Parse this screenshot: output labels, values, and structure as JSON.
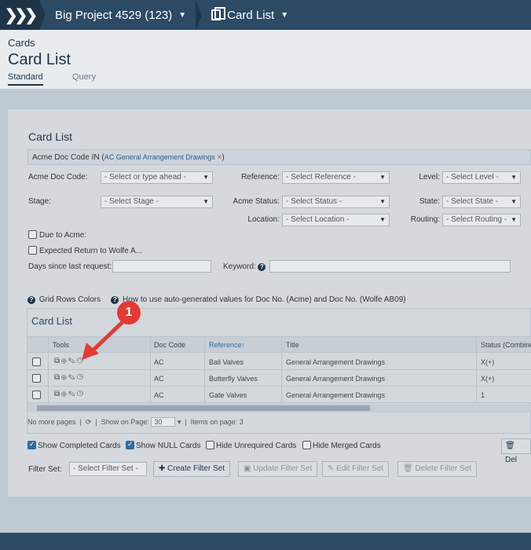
{
  "nav": {
    "project": "Big Project 4529 (123)",
    "page": "Card List"
  },
  "header": {
    "section": "Cards",
    "title": "Card List",
    "tabs": [
      "Standard",
      "Query"
    ]
  },
  "card": {
    "title": "Card List",
    "filter_prefix": "Acme Doc Code IN (",
    "filter_tag": "AC General Arrangement Drawings",
    "filter_close": "×",
    "filter_suffix": ")"
  },
  "filters": {
    "acme_doc_code": {
      "label": "Acme Doc Code:",
      "value": "- Select or type ahead -"
    },
    "reference": {
      "label": "Reference:",
      "value": "- Select Reference -"
    },
    "level": {
      "label": "Level:",
      "value": "- Select Level -"
    },
    "stage": {
      "label": "Stage:",
      "value": "- Select Stage -"
    },
    "acme_status": {
      "label": "Acme Status:",
      "value": "- Select Status -"
    },
    "state": {
      "label": "State:",
      "value": "- Select State -"
    },
    "location": {
      "label": "Location:",
      "value": "- Select Location -"
    },
    "routing": {
      "label": "Routing:",
      "value": "- Select Routing -"
    },
    "due_to_acme": "Due to Acme:",
    "expected_return": "Expected Return to Wolfe A...",
    "days_since": "Days since last request:",
    "keyword": "Keyword:"
  },
  "help_links": {
    "grid_colors": "Grid Rows Colors",
    "auto_values": "How to use auto-generated values for Doc No. (Acme) and Doc No. (Wolfe AB09)"
  },
  "grid": {
    "title": "Card List",
    "columns": [
      "Tools",
      "Doc Code",
      "Reference",
      "Title",
      "Status (Combine"
    ],
    "sort_indicator": "↑",
    "rows": [
      {
        "doc_code": "AC",
        "reference": "Ball Valves",
        "title": "General Arrangement Drawings",
        "status": "X(+)"
      },
      {
        "doc_code": "AC",
        "reference": "Butterfly Valves",
        "title": "General Arrangement Drawings",
        "status": "X(+)"
      },
      {
        "doc_code": "AC",
        "reference": "Gate Valves",
        "title": "General Arrangement Drawings",
        "status": "1"
      }
    ],
    "pager_text": "No more pages",
    "show_on_page_label": "Show on Page:",
    "page_size": "30",
    "items_on_page": "Items on page: 3"
  },
  "options": {
    "show_completed": "Show Completed Cards",
    "show_null": "Show NULL Cards",
    "hide_unrequired": "Hide Unrequired Cards",
    "hide_merged": "Hide Merged Cards",
    "delete_label": "Del"
  },
  "filter_set": {
    "label": "Filter Set:",
    "select": "- Select Filter Set -",
    "create": "Create Filter Set",
    "update": "Update Filter Set",
    "edit": "Edit Filter Set",
    "delete": "Delete Filter Set"
  },
  "annotation": {
    "marker": "1"
  }
}
